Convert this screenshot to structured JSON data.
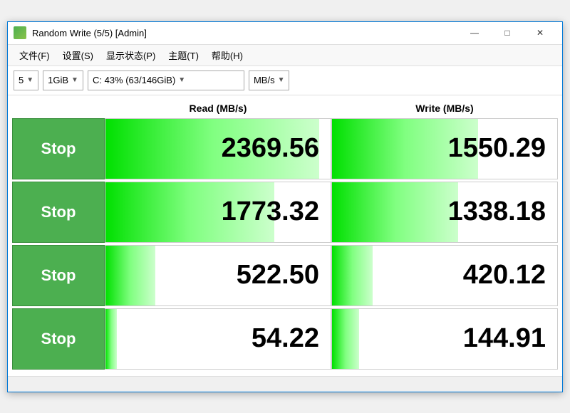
{
  "window": {
    "title": "Random Write (5/5) [Admin]",
    "icon_label": "app-icon"
  },
  "title_controls": {
    "minimize": "—",
    "maximize": "□",
    "close": "✕"
  },
  "menu": {
    "items": [
      {
        "label": "文件(F)"
      },
      {
        "label": "设置(S)"
      },
      {
        "label": "显示状态(P)"
      },
      {
        "label": "主题(T)"
      },
      {
        "label": "帮助(H)"
      }
    ]
  },
  "toolbar": {
    "count": "5",
    "size": "1GiB",
    "drive": "C: 43% (63/146GiB)",
    "unit": "MB/s"
  },
  "header": {
    "col1": "",
    "col2": "Read (MB/s)",
    "col3": "Write (MB/s)"
  },
  "rows": [
    {
      "stop_label": "Stop",
      "read_value": "2369.56",
      "write_value": "1550.29",
      "read_fill_pct": 95,
      "write_fill_pct": 65
    },
    {
      "stop_label": "Stop",
      "read_value": "1773.32",
      "write_value": "1338.18",
      "read_fill_pct": 75,
      "write_fill_pct": 56
    },
    {
      "stop_label": "Stop",
      "read_value": "522.50",
      "write_value": "420.12",
      "read_fill_pct": 22,
      "write_fill_pct": 18
    },
    {
      "stop_label": "Stop",
      "read_value": "54.22",
      "write_value": "144.91",
      "read_fill_pct": 5,
      "write_fill_pct": 12
    }
  ]
}
